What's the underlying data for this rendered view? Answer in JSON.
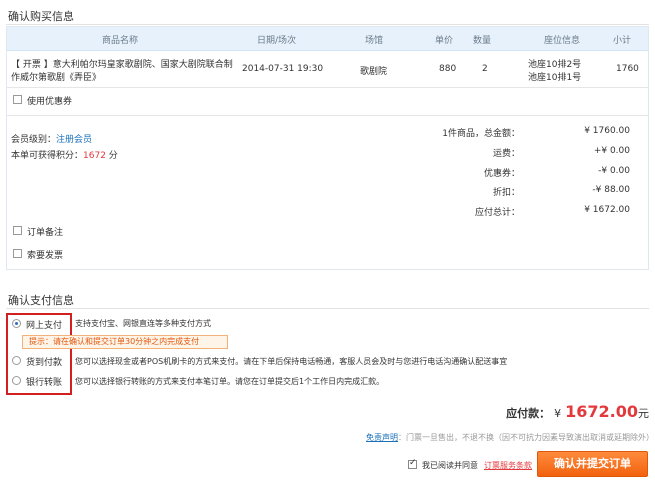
{
  "confirm_purchase": {
    "title": "确认购买信息",
    "columns": [
      "商品名称",
      "日期/场次",
      "场馆",
      "单价",
      "数量",
      "座位信息",
      "小计"
    ],
    "item": {
      "name_line1": "【 开票 】意大利帕尔玛皇家歌剧院、国家大剧院联合制",
      "name_line2": "作威尔第歌剧《弄臣》",
      "datetime": "2014-07-31  19:30",
      "venue": "歌剧院",
      "price": "880",
      "quantity": "2",
      "seat_line1": "池座10排2号",
      "seat_line2": "池座10排1号",
      "subtotal": "1760"
    },
    "use_coupon_label": "使用优惠券",
    "member_level_label": "会员级别：",
    "member_level_link": "注册会员",
    "points_label": "本单可获得积分：",
    "points_value": "1672",
    "points_unit": "分",
    "summary": {
      "count_label": "1件商品，总金额：",
      "total_amount": "¥ 1760.00",
      "shipping_label": "运费：",
      "shipping_value": "+¥ 0.00",
      "coupon_label": "优惠券：",
      "coupon_value": "-¥ 0.00",
      "discount_label": "折扣：",
      "discount_value": "-¥ 88.00",
      "grand_label": "应付总计：",
      "grand_value": "¥ 1672.00"
    },
    "order_note_label": "订单备注",
    "invoice_label": "索要发票"
  },
  "payment": {
    "title": "确认支付信息",
    "options": [
      {
        "label": "网上支付",
        "desc": "支持支付宝、网银直连等多种支付方式",
        "selected": true
      },
      {
        "label": "货到付款",
        "desc": "您可以选择现金或者POS机刷卡的方式来支付。请在下单后保持电话畅通，客服人员会及时与您进行电话沟通确认配送事宜",
        "selected": false
      },
      {
        "label": "银行转账",
        "desc": "您可以选择银行转账的方式来支付本笔订单。请您在订单提交后1个工作日内完成汇款。",
        "selected": false
      }
    ],
    "tip": "提示：请在确认和提交订单30分钟之内完成支付"
  },
  "footer": {
    "payable_label": "应付款：",
    "currency": "¥",
    "payable_amount": "1672.00",
    "payable_unit": "元",
    "disclaimer_link": "免责声明",
    "disclaimer_text": "：门票一旦售出，不退不换（因不可抗力因素导致演出取消或延期除外）",
    "agree_text": "我已阅读并同意",
    "agree_link": "订票服务条款",
    "submit_label": "确认并提交订单"
  },
  "colors": {
    "accent": "#1a6fb9",
    "highlight": "#e4393c",
    "button": "#f1620d",
    "header_bg": "#e6f1fb"
  }
}
